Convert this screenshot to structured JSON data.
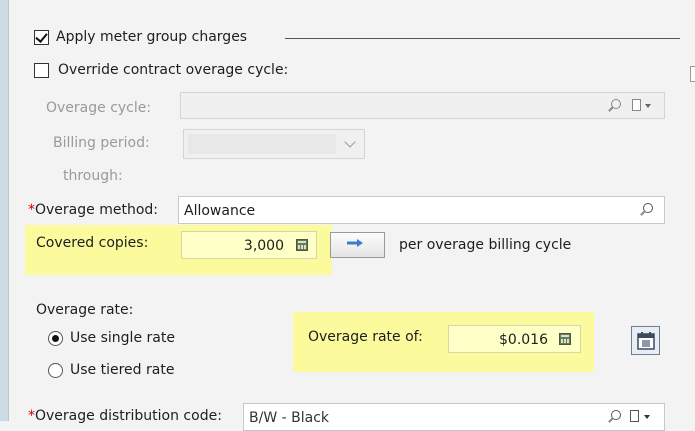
{
  "apply_meter": {
    "label": "Apply meter group charges",
    "checked": true
  },
  "override_cycle": {
    "label": "Override contract overage cycle:",
    "checked": false
  },
  "overage_cycle": {
    "label": "Overage cycle:",
    "value": ""
  },
  "billing_period": {
    "label": "Billing period:",
    "value": ""
  },
  "through": {
    "label": "through:"
  },
  "overage_method": {
    "required_mark": "*",
    "label": "Overage method:",
    "value": "Allowance"
  },
  "covered_copies": {
    "label": "Covered copies:",
    "value": "3,000"
  },
  "per_cycle_label": "per overage billing cycle",
  "overage_rate": {
    "heading": "Overage rate:",
    "options": [
      {
        "label": "Use single rate",
        "selected": true
      },
      {
        "label": "Use tiered rate",
        "selected": false
      }
    ],
    "rate_label": "Overage rate of:",
    "rate_value": "$0.016"
  },
  "distribution": {
    "required_mark": "*",
    "label": "Overage distribution code:",
    "value": "B/W - Black"
  },
  "colors": {
    "highlight": "#fbfb9d",
    "required": "#d00000",
    "accent_arrow": "#3d7bd0"
  },
  "icons": [
    "checkbox-checked",
    "checkbox-unchecked",
    "search-icon",
    "document-dropdown-icon",
    "chevron-down-icon",
    "calculator-icon",
    "arrow-right-icon",
    "radio-selected",
    "radio-unselected",
    "calendar-calculator-icon"
  ]
}
